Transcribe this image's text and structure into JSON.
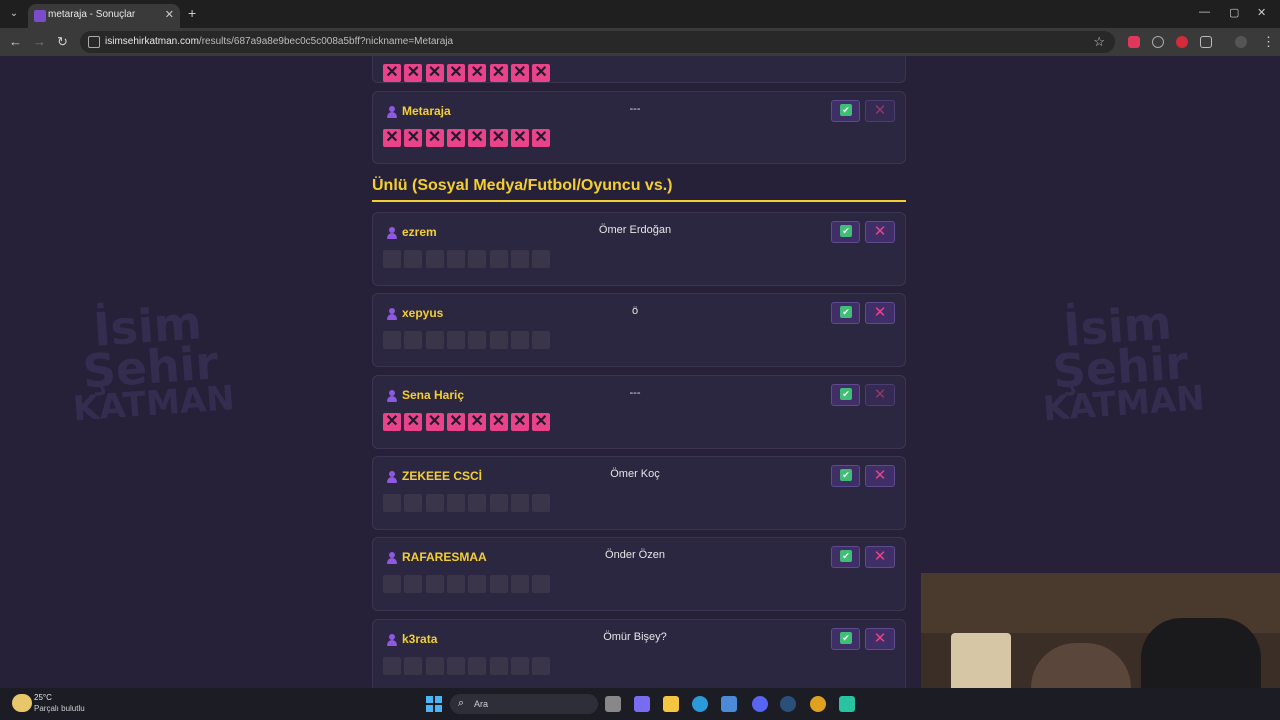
{
  "browser": {
    "tab_title": "metaraja - Sonuçlar",
    "url_host": "isimsehirkatman.com",
    "url_path": "/results/687a9a8e9bec0c5c008a5bff?nickname=Metaraja"
  },
  "background": {
    "logo_words": [
      "İsim",
      "Şehir",
      "KATMAN"
    ]
  },
  "top_partial_card": {
    "box_count": 8
  },
  "previous_card": {
    "nickname": "Metaraja",
    "answer": "---"
  },
  "section": {
    "title": "Ünlü (Sosyal Medya/Futbol/Oyuncu vs.)"
  },
  "entries": [
    {
      "nickname": "ezrem",
      "answer": "Ömer Erdoğan",
      "marked_wrong": false
    },
    {
      "nickname": "xepyus",
      "answer": "ö",
      "marked_wrong": false
    },
    {
      "nickname": "Sena Hariç",
      "answer": "---",
      "marked_wrong": true
    },
    {
      "nickname": "ZEKEEE CSCİ",
      "answer": "Ömer Koç",
      "marked_wrong": false
    },
    {
      "nickname": "RAFARESMAA",
      "answer": "Önder Özen",
      "marked_wrong": false
    },
    {
      "nickname": "k3rata",
      "answer": "Ömür Bişey?",
      "marked_wrong": false
    }
  ],
  "taskbar": {
    "temperature": "25°C",
    "weather": "Parçalı bulutlu",
    "search_placeholder": "Ara"
  },
  "colors": {
    "accent": "#f4cf31",
    "wrong": "#e9438a",
    "ok": "#3fbf75",
    "card": "#2c2741",
    "page_bg": "#262139"
  }
}
